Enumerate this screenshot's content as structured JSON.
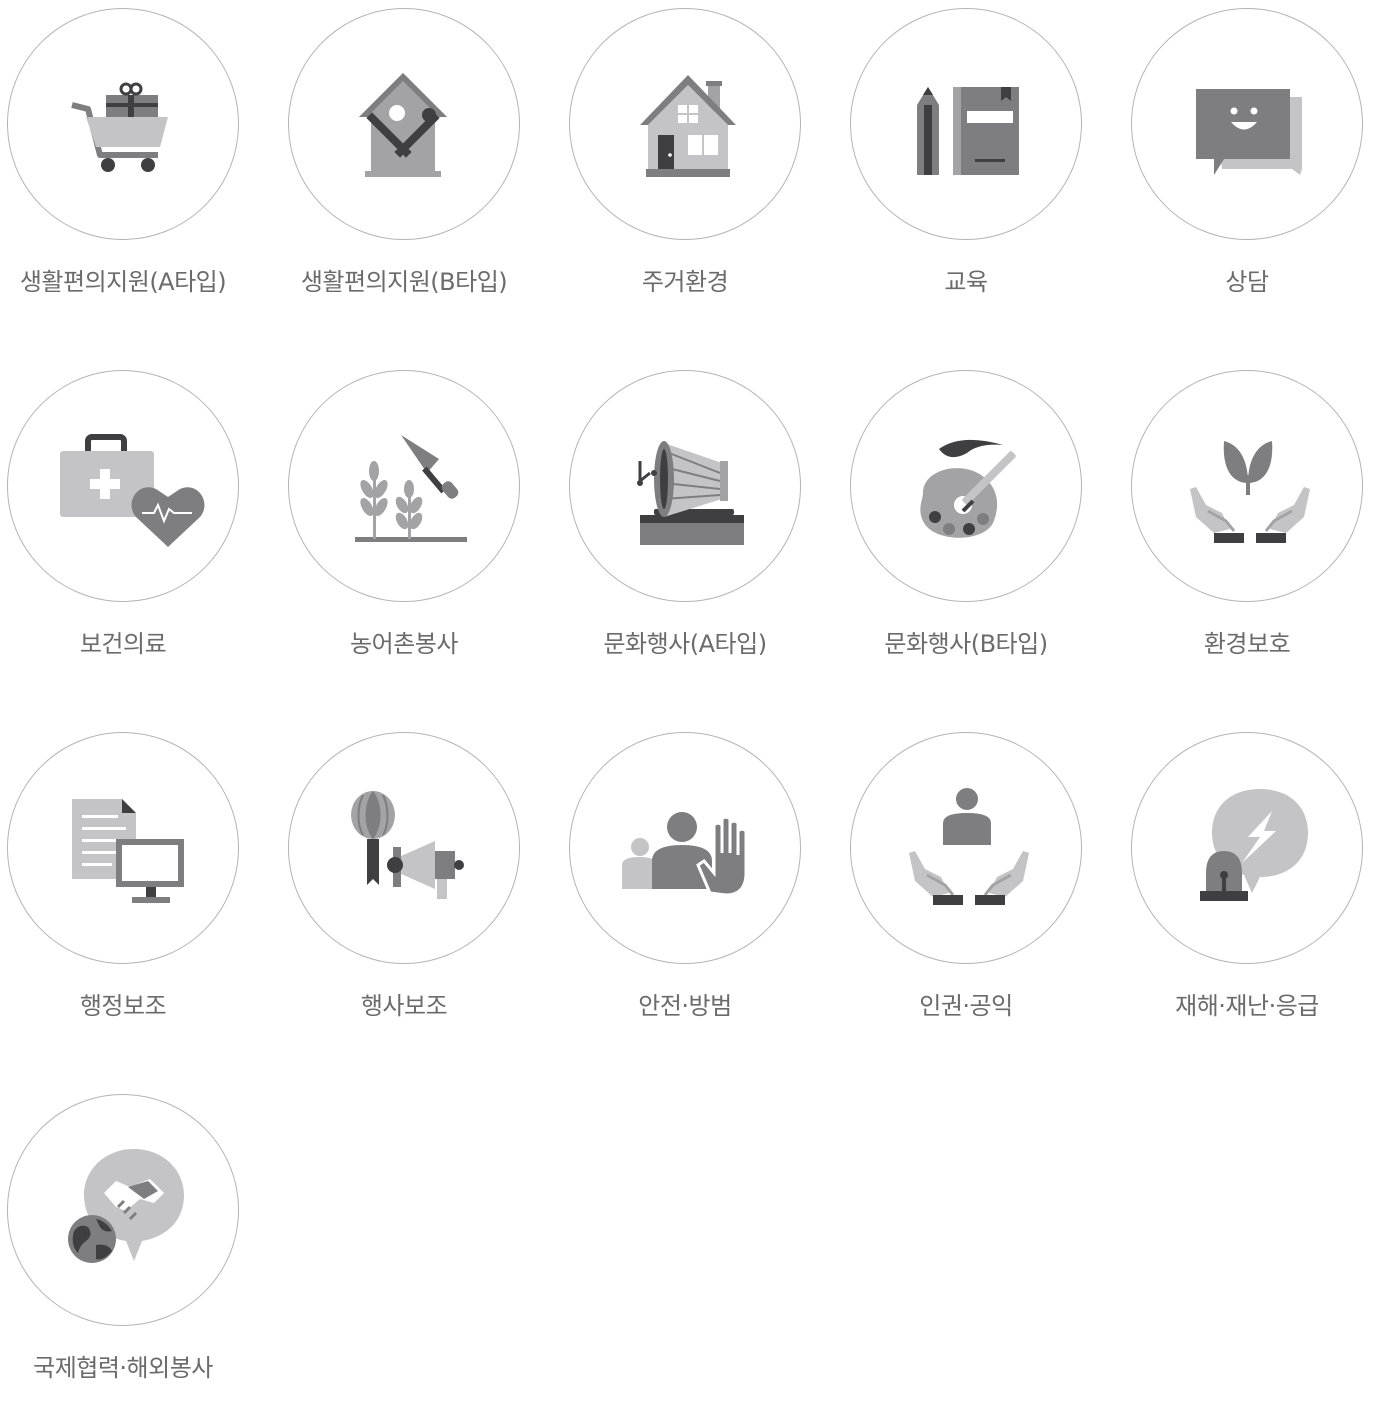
{
  "categories": [
    {
      "label": "생활편의지원(A타입)",
      "icon": "shopping-cart-gift-icon"
    },
    {
      "label": "생활편의지원(B타입)",
      "icon": "house-repair-tools-icon"
    },
    {
      "label": "주거환경",
      "icon": "house-icon"
    },
    {
      "label": "교육",
      "icon": "pencil-book-icon"
    },
    {
      "label": "상담",
      "icon": "chat-bubble-smile-icon"
    },
    {
      "label": "보건의료",
      "icon": "medical-kit-heart-icon"
    },
    {
      "label": "농어촌봉사",
      "icon": "wheat-trowel-icon"
    },
    {
      "label": "문화행사(A타입)",
      "icon": "gramophone-icon"
    },
    {
      "label": "문화행사(B타입)",
      "icon": "paint-palette-icon"
    },
    {
      "label": "환경보호",
      "icon": "hands-sprout-icon"
    },
    {
      "label": "행정보조",
      "icon": "document-monitor-icon"
    },
    {
      "label": "행사보조",
      "icon": "balloon-megaphone-icon"
    },
    {
      "label": "안전·방범",
      "icon": "people-stop-hand-icon"
    },
    {
      "label": "인권·공익",
      "icon": "hands-person-icon"
    },
    {
      "label": "재해·재난·응급",
      "icon": "siren-lightning-icon"
    },
    {
      "label": "국제협력·해외봉사",
      "icon": "globe-handshake-icon"
    }
  ],
  "colors": {
    "dark": "#7e7e80",
    "mid": "#a3a3a5",
    "light": "#c4c4c6",
    "darkest": "#3f3f41",
    "border": "#b4b4b4",
    "label": "#6b6b6b"
  }
}
